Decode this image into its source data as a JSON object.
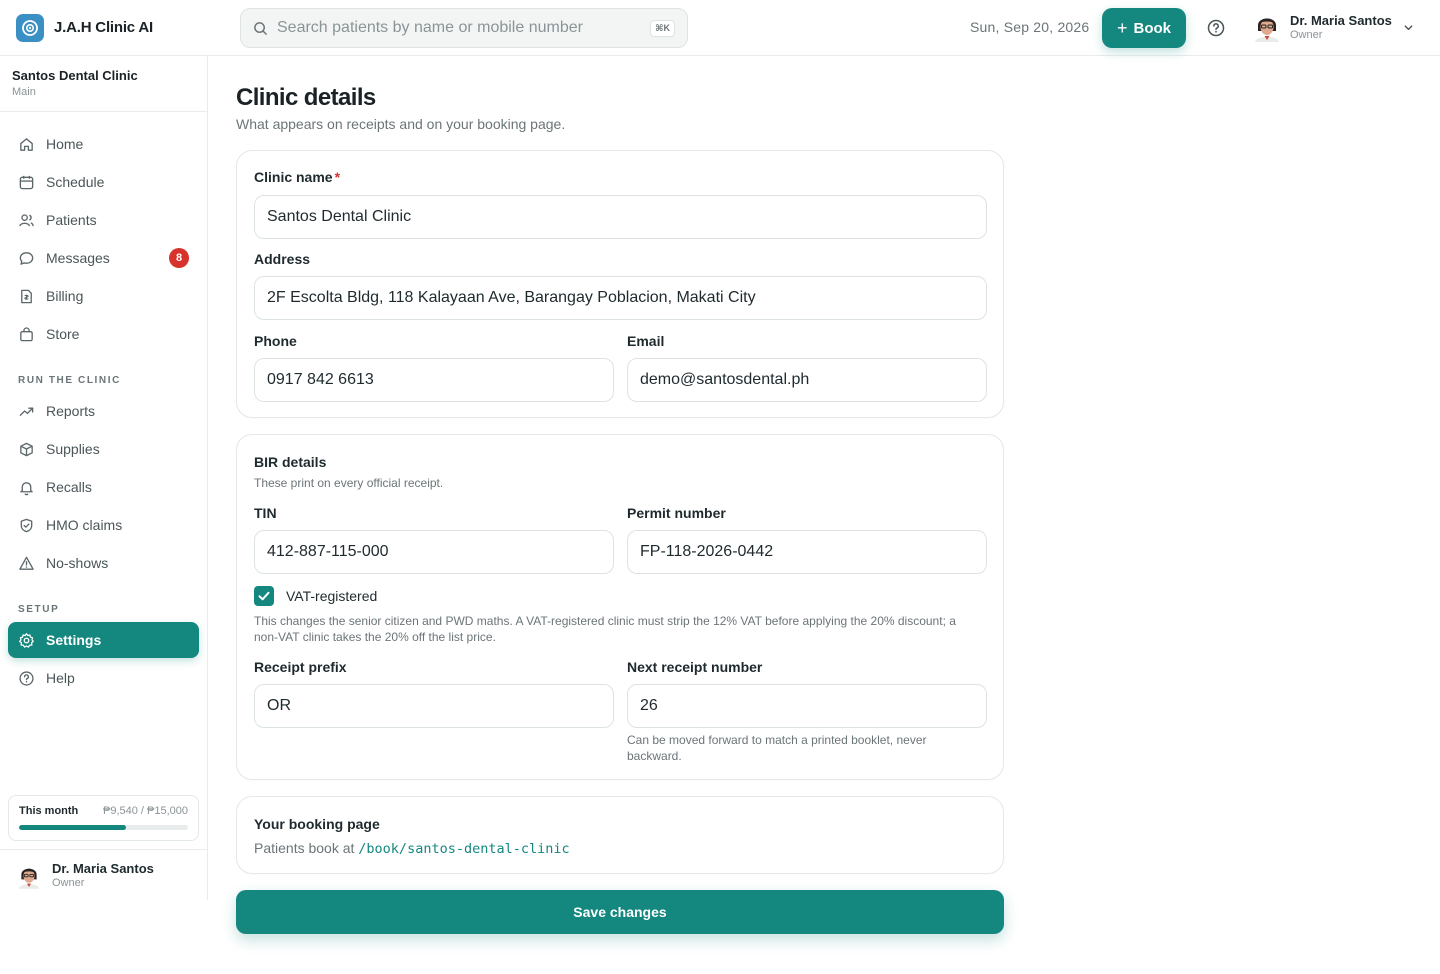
{
  "app": {
    "name": "J.A.H Clinic AI"
  },
  "topbar": {
    "search_placeholder": "Search patients by name or mobile number",
    "shortcut": "⌘K",
    "date": "Sun, Sep 20, 2026",
    "book_label": "Book",
    "user_name": "Dr. Maria Santos",
    "user_role": "Owner"
  },
  "sidebar": {
    "clinic_name": "Santos Dental Clinic",
    "branch": "Main",
    "items": [
      {
        "label": "Home",
        "icon": "home-icon"
      },
      {
        "label": "Schedule",
        "icon": "calendar-icon"
      },
      {
        "label": "Patients",
        "icon": "users-icon"
      },
      {
        "label": "Messages",
        "icon": "message-icon",
        "badge": "8"
      },
      {
        "label": "Billing",
        "icon": "receipt-icon"
      },
      {
        "label": "Store",
        "icon": "bag-icon"
      }
    ],
    "run_label": "RUN THE CLINIC",
    "run_items": [
      {
        "label": "Reports",
        "icon": "trend-icon"
      },
      {
        "label": "Supplies",
        "icon": "box-icon"
      },
      {
        "label": "Recalls",
        "icon": "bell-icon"
      },
      {
        "label": "HMO claims",
        "icon": "shield-icon"
      },
      {
        "label": "No-shows",
        "icon": "warning-icon"
      }
    ],
    "setup_label": "SETUP",
    "setup_items": [
      {
        "label": "Settings",
        "icon": "gear-icon",
        "active": true
      },
      {
        "label": "Help",
        "icon": "help-icon"
      }
    ],
    "month": {
      "label": "This month",
      "value": "₱9,540 / ₱15,000",
      "progress": 0.636
    },
    "user_name": "Dr. Maria Santos",
    "user_role": "Owner"
  },
  "page": {
    "title": "Clinic details",
    "subtitle": "What appears on receipts and on your booking page."
  },
  "clinic_card": {
    "name_label": "Clinic name",
    "required_mark": "*",
    "name_value": "Santos Dental Clinic",
    "address_label": "Address",
    "address_value": "2F Escolta Bldg, 118 Kalayaan Ave, Barangay Poblacion, Makati City",
    "phone_label": "Phone",
    "phone_value": "0917 842 6613",
    "email_label": "Email",
    "email_value": "demo@santosdental.ph"
  },
  "bir_card": {
    "title": "BIR details",
    "subtitle": "These print on every official receipt.",
    "tin_label": "TIN",
    "tin_value": "412-887-115-000",
    "permit_label": "Permit number",
    "permit_value": "FP-118-2026-0442",
    "vat_label": "VAT-registered",
    "vat_checked": true,
    "vat_help": "This changes the senior citizen and PWD maths. A VAT-registered clinic must strip the 12% VAT before applying the 20% discount; a non-VAT clinic takes the 20% off the list price.",
    "prefix_label": "Receipt prefix",
    "prefix_value": "OR",
    "next_label": "Next receipt number",
    "next_value": "26",
    "next_help": "Can be moved forward to match a printed booklet, never backward."
  },
  "booking_card": {
    "title": "Your booking page",
    "prefix_text": "Patients book at",
    "url": "/book/santos-dental-clinic"
  },
  "save_label": "Save changes",
  "colors": {
    "accent": "#14877f",
    "badge": "#d8322c",
    "logo": "#3a8fc4"
  }
}
